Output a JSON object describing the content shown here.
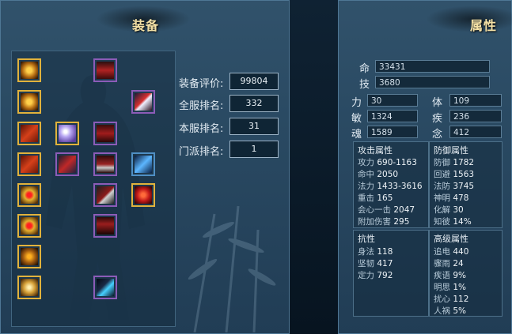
{
  "equipment_panel": {
    "title": "装备",
    "slots": [
      {
        "icon": "gold-sun-emblem-icon",
        "quality": "gold"
      },
      {
        "icon": "red-armor-helm-icon",
        "quality": "purple"
      },
      {
        "icon": "gold-sun-emblem-icon",
        "quality": "gold"
      },
      {
        "icon": "red-sword-weapon-icon",
        "quality": "purple"
      },
      {
        "icon": "red-talisman-icon",
        "quality": "gold"
      },
      {
        "icon": "purple-crystal-icon",
        "quality": "gold"
      },
      {
        "icon": "red-chest-armor-icon",
        "quality": "purple"
      },
      {
        "icon": "red-talisman-icon",
        "quality": "gold"
      },
      {
        "icon": "red-bracer-icon",
        "quality": "purple"
      },
      {
        "icon": "red-shoulder-armor-icon",
        "quality": "purple"
      },
      {
        "icon": "blue-crystal-weapon-icon",
        "quality": "blue"
      },
      {
        "icon": "red-gem-amulet-icon",
        "quality": "gold"
      },
      {
        "icon": "red-gauntlet-icon",
        "quality": "purple"
      },
      {
        "icon": "red-orb-gem-icon",
        "quality": "gold"
      },
      {
        "icon": "red-gem-amulet-icon",
        "quality": "gold"
      },
      {
        "icon": "red-leggings-icon",
        "quality": "purple"
      },
      {
        "icon": "gold-dragon-ring-icon",
        "quality": "gold"
      },
      {
        "icon": "gold-spiral-ring-icon",
        "quality": "gold"
      },
      {
        "icon": "blue-boots-icon",
        "quality": "purple"
      }
    ],
    "stats": [
      {
        "label": "装备评价:",
        "value": "99804"
      },
      {
        "label": "全服排名:",
        "value": "332"
      },
      {
        "label": "本服排名:",
        "value": "31"
      },
      {
        "label": "门派排名:",
        "value": "1"
      }
    ]
  },
  "attribute_panel": {
    "title": "属性",
    "life": {
      "label": "命",
      "value": "33431"
    },
    "skill": {
      "label": "技",
      "value": "3680"
    },
    "base": [
      {
        "label": "力",
        "value": "30"
      },
      {
        "label": "体",
        "value": "109"
      },
      {
        "label": "敏",
        "value": "1324"
      },
      {
        "label": "疾",
        "value": "236"
      },
      {
        "label": "魂",
        "value": "1589"
      },
      {
        "label": "念",
        "value": "412"
      }
    ],
    "attack": {
      "title": "攻击属性",
      "rows": [
        {
          "name": "攻力",
          "value": "690-1163"
        },
        {
          "name": "命中",
          "value": "2050"
        },
        {
          "name": "法力",
          "value": "1433-3616"
        },
        {
          "name": "重击",
          "value": "165"
        },
        {
          "name": "会心一击",
          "value": "2047"
        },
        {
          "name": "附加伤害",
          "value": "295"
        }
      ]
    },
    "defense": {
      "title": "防御属性",
      "rows": [
        {
          "name": "防御",
          "value": "1782"
        },
        {
          "name": "回避",
          "value": "1563"
        },
        {
          "name": "法防",
          "value": "3745"
        },
        {
          "name": "神明",
          "value": "478"
        },
        {
          "name": "化解",
          "value": "30"
        },
        {
          "name": "知彼",
          "value": "14%"
        }
      ]
    },
    "resist": {
      "title": "抗性",
      "rows": [
        {
          "name": "身法",
          "value": "118"
        },
        {
          "name": "坚韧",
          "value": "417"
        },
        {
          "name": "定力",
          "value": "792"
        }
      ]
    },
    "advanced": {
      "title": "高级属性",
      "rows": [
        {
          "name": "追电",
          "value": "440"
        },
        {
          "name": "骤雨",
          "value": "24"
        },
        {
          "name": "疾语",
          "value": "9%"
        },
        {
          "name": "明思",
          "value": "1%"
        },
        {
          "name": "扰心",
          "value": "112"
        },
        {
          "name": "人祸",
          "value": "5%"
        }
      ]
    }
  },
  "colors": {
    "gold": "#e1b23c",
    "purple": "#8c5cb8",
    "blue": "#4f8fc4",
    "title": "#f4e1a6"
  }
}
